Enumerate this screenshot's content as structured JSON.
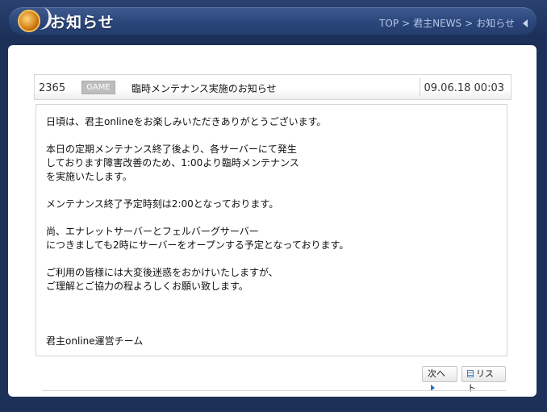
{
  "header": {
    "title": "お知らせ",
    "breadcrumb": [
      "TOP",
      "君主NEWS",
      "お知らせ"
    ],
    "breadcrumb_separator": ">"
  },
  "post": {
    "number": "2365",
    "category": "GAME",
    "title": "臨時メンテナンス実施のお知らせ",
    "date": "09.06.18 00:03",
    "body": [
      "日頃は、君主onlineをお楽しみいただきありがとうございます。",
      "本日の定期メンテナンス終了後より、各サーバーにて発生\nしております障害改善のため、1:00より臨時メンテナンス\nを実施いたします。",
      "メンテナンス終了予定時刻は2:00となっております。",
      "尚、エナレットサーバーとフェルバーグサーバー\nにつきましても2時にサーバーをオープンする予定となっております。",
      "ご利用の皆様には大変後迷惑をおかけいたしますが、\nご理解とご協力の程よろしくお願い致します。"
    ],
    "signature": "君主online運営チーム"
  },
  "nav": {
    "next_label": "次へ",
    "list_label": "リスト"
  },
  "colors": {
    "background": "#1d3158",
    "header_pill": "#2a467b",
    "panel": "#ffffff",
    "badge": "#bdbdbd"
  }
}
